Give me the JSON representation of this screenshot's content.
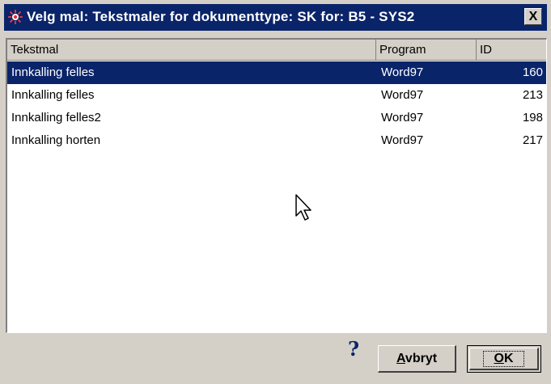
{
  "window": {
    "title": "Velg mal: Tekstmaler for dokumenttype: SK for: B5 - SYS2",
    "close_label": "X"
  },
  "list": {
    "columns": [
      {
        "label": "Tekstmal"
      },
      {
        "label": "Program"
      },
      {
        "label": "ID"
      }
    ],
    "rows": [
      {
        "name": "Innkalling felles",
        "program": "Word97",
        "id": "160",
        "selected": true
      },
      {
        "name": "Innkalling felles",
        "program": "Word97",
        "id": "213",
        "selected": false
      },
      {
        "name": "Innkalling felles2",
        "program": "Word97",
        "id": "198",
        "selected": false
      },
      {
        "name": "Innkalling horten",
        "program": "Word97",
        "id": "217",
        "selected": false
      }
    ]
  },
  "footer": {
    "help_symbol": "?",
    "cancel_label": {
      "mnemonic": "A",
      "rest": "vbryt"
    },
    "ok_label": {
      "mnemonic": "O",
      "rest": "K"
    }
  },
  "colors": {
    "titlebar": "#0a246a",
    "selection": "#0a246a",
    "face": "#d4d0c8"
  }
}
